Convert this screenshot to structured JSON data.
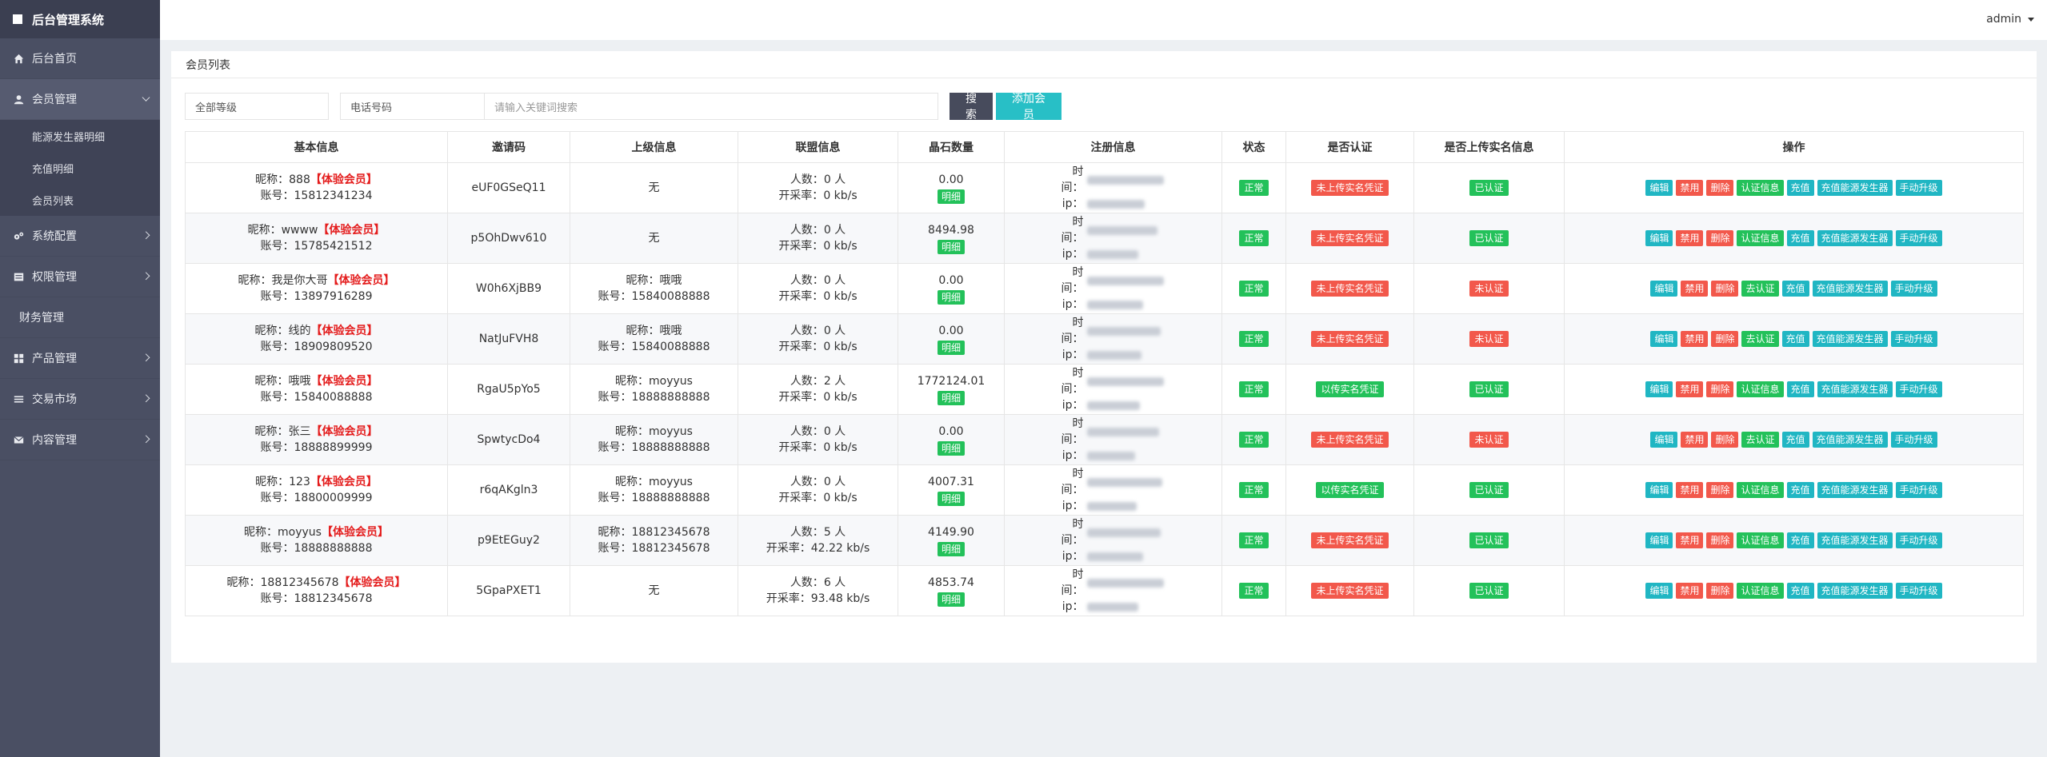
{
  "app": {
    "title": "后台管理系统"
  },
  "sidebar": {
    "items": [
      {
        "label": "后台首页",
        "icon": "home-icon"
      },
      {
        "label": "会员管理",
        "icon": "user-icon",
        "expanded": true,
        "children": [
          "能源发生器明细",
          "充值明细",
          "会员列表"
        ]
      },
      {
        "label": "系统配置",
        "icon": "gears-icon"
      },
      {
        "label": "权限管理",
        "icon": "list-icon"
      },
      {
        "label": "财务管理",
        "icon": ""
      },
      {
        "label": "产品管理",
        "icon": "grid-icon"
      },
      {
        "label": "交易市场",
        "icon": "menu-icon"
      },
      {
        "label": "内容管理",
        "icon": "envelope-icon"
      }
    ]
  },
  "topbar": {
    "user": "admin"
  },
  "panel": {
    "title": "会员列表",
    "filters": {
      "level": "全部等级",
      "phone_label": "电话号码",
      "keyword_placeholder": "请输入关键词搜索"
    },
    "buttons": {
      "search": "搜索",
      "add": "添加会员"
    }
  },
  "table": {
    "headers": [
      "基本信息",
      "邀请码",
      "上级信息",
      "联盟信息",
      "晶石数量",
      "注册信息",
      "状态",
      "是否认证",
      "是否上传实名信息",
      "操作"
    ],
    "labels": {
      "nick": "昵称：",
      "account": "账号：",
      "people": "人数：",
      "rate": "开采率：",
      "time": "时间：",
      "ip": "ip：",
      "detail": "明细",
      "vip": "【体验会员】",
      "none": "无"
    },
    "rows": [
      {
        "nick": "888",
        "account": "15812341234",
        "code": "eUF0GSeQ11",
        "parent": null,
        "people": "0 人",
        "rate": "0 kb/s",
        "crystal": "0.00",
        "status": "正常",
        "cert": "未上传实名凭证",
        "real": "已认证",
        "real_ok": true,
        "cert_ok": false,
        "auth": "认证信息"
      },
      {
        "nick": "wwww",
        "account": "15785421512",
        "code": "p5OhDwv610",
        "parent": null,
        "people": "0 人",
        "rate": "0 kb/s",
        "crystal": "8494.98",
        "status": "正常",
        "cert": "未上传实名凭证",
        "real": "已认证",
        "real_ok": true,
        "cert_ok": false,
        "auth": "认证信息"
      },
      {
        "nick": "我是你大哥",
        "account": "13897916289",
        "code": "W0h6XjBB9",
        "parent": {
          "nick": "哦哦",
          "account": "15840088888"
        },
        "people": "0 人",
        "rate": "0 kb/s",
        "crystal": "0.00",
        "status": "正常",
        "cert": "未上传实名凭证",
        "real": "未认证",
        "real_ok": false,
        "cert_ok": false,
        "auth": "去认证"
      },
      {
        "nick": "线的",
        "account": "18909809520",
        "code": "NatJuFVH8",
        "parent": {
          "nick": "哦哦",
          "account": "15840088888"
        },
        "people": "0 人",
        "rate": "0 kb/s",
        "crystal": "0.00",
        "status": "正常",
        "cert": "未上传实名凭证",
        "real": "未认证",
        "real_ok": false,
        "cert_ok": false,
        "auth": "去认证"
      },
      {
        "nick": "哦哦",
        "account": "15840088888",
        "code": "RgaU5pYo5",
        "parent": {
          "nick": "moyyus",
          "account": "18888888888"
        },
        "people": "2 人",
        "rate": "0 kb/s",
        "crystal": "1772124.01",
        "status": "正常",
        "cert": "以传实名凭证",
        "real": "已认证",
        "real_ok": true,
        "cert_ok": true,
        "auth": "认证信息"
      },
      {
        "nick": "张三",
        "account": "18888899999",
        "code": "SpwtycDo4",
        "parent": {
          "nick": "moyyus",
          "account": "18888888888"
        },
        "people": "0 人",
        "rate": "0 kb/s",
        "crystal": "0.00",
        "status": "正常",
        "cert": "未上传实名凭证",
        "real": "未认证",
        "real_ok": false,
        "cert_ok": false,
        "auth": "去认证"
      },
      {
        "nick": "123",
        "account": "18800009999",
        "code": "r6qAKgln3",
        "parent": {
          "nick": "moyyus",
          "account": "18888888888"
        },
        "people": "0 人",
        "rate": "0 kb/s",
        "crystal": "4007.31",
        "status": "正常",
        "cert": "以传实名凭证",
        "real": "已认证",
        "real_ok": true,
        "cert_ok": true,
        "auth": "认证信息"
      },
      {
        "nick": "moyyus",
        "account": "18888888888",
        "code": "p9EtEGuy2",
        "parent": {
          "nick": "18812345678",
          "account": "18812345678"
        },
        "people": "5 人",
        "rate": "42.22 kb/s",
        "crystal": "4149.90",
        "status": "正常",
        "cert": "未上传实名凭证",
        "real": "已认证",
        "real_ok": true,
        "cert_ok": false,
        "auth": "认证信息"
      },
      {
        "nick": "18812345678",
        "account": "18812345678",
        "code": "5GpaPXET1",
        "parent": null,
        "people": "6 人",
        "rate": "93.48 kb/s",
        "crystal": "4853.74",
        "status": "正常",
        "cert": "未上传实名凭证",
        "real": "已认证",
        "real_ok": true,
        "cert_ok": false,
        "auth": "认证信息"
      }
    ],
    "ops": {
      "edit": "编辑",
      "ban": "禁用",
      "del": "删除",
      "recharge": "充值",
      "gen": "充值能源发生器",
      "upgrade": "手动升级"
    }
  },
  "colors": {
    "sidebar": "#4a4f63",
    "teal": "#28bfc6",
    "green": "#23c15a",
    "red": "#f2584b"
  }
}
